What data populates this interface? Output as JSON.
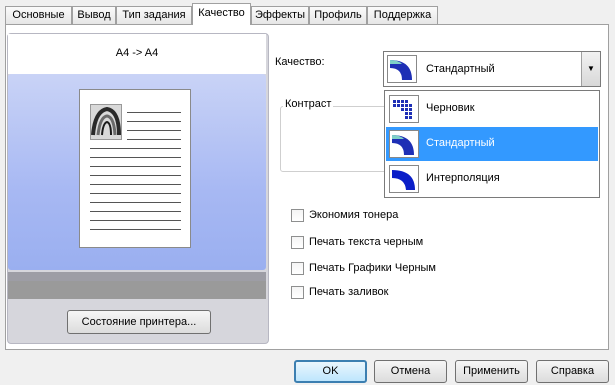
{
  "tabs": [
    {
      "label": "Основные"
    },
    {
      "label": "Вывод"
    },
    {
      "label": "Тип задания"
    },
    {
      "label": "Качество"
    },
    {
      "label": "Эффекты"
    },
    {
      "label": "Профиль"
    },
    {
      "label": "Поддержка"
    }
  ],
  "active_tab": "Качество",
  "preview": {
    "paper_mapping": "A4 -> A4",
    "printer_status_button": "Состояние принтера..."
  },
  "quality": {
    "label": "Качество:",
    "selected": "Стандартный",
    "options": [
      {
        "label": "Черновик",
        "icon": "draft-quality-icon"
      },
      {
        "label": "Стандартный",
        "icon": "standard-quality-icon"
      },
      {
        "label": "Интерполяция",
        "icon": "interpolation-quality-icon"
      }
    ]
  },
  "contrast": {
    "label": "Контраст"
  },
  "checkboxes": [
    {
      "label": "Экономия тонера",
      "checked": false
    },
    {
      "label": "Печать текста черным",
      "checked": false
    },
    {
      "label": "Печать Графики Черным",
      "checked": false
    },
    {
      "label": "Печать заливок",
      "checked": false
    }
  ],
  "buttons": {
    "ok": "OK",
    "cancel": "Отмена",
    "apply": "Применить",
    "help": "Справка"
  },
  "colors": {
    "selection": "#3399ff",
    "preview_blue": "#a7b8f3",
    "default_button_border": "#3c7fb1"
  }
}
